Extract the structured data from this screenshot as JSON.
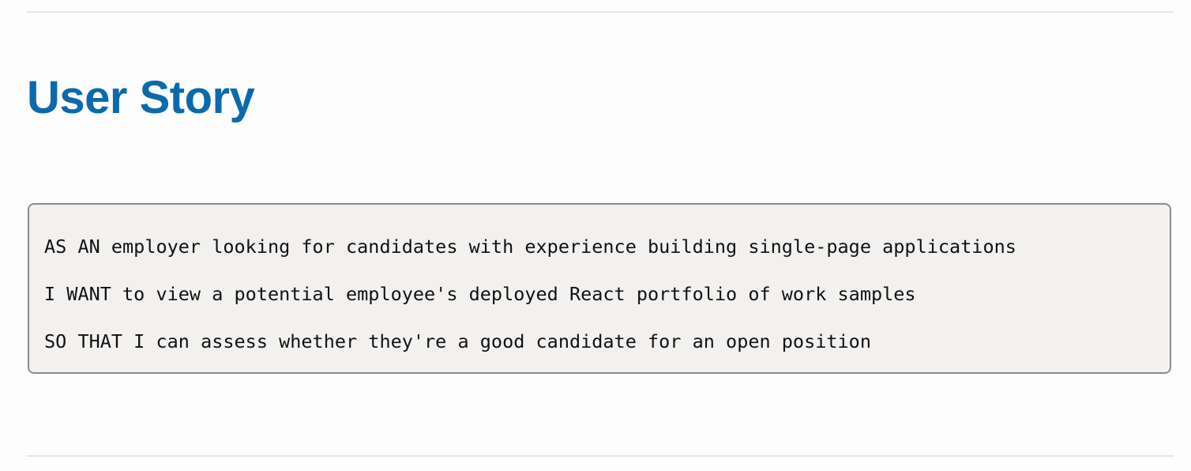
{
  "section": {
    "title": "User Story"
  },
  "story": {
    "lines": [
      "AS AN employer looking for candidates with experience building single-page applications",
      "I WANT to view a potential employee's deployed React portfolio of work samples",
      "SO THAT I can assess whether they're a good candidate for an open position"
    ]
  }
}
